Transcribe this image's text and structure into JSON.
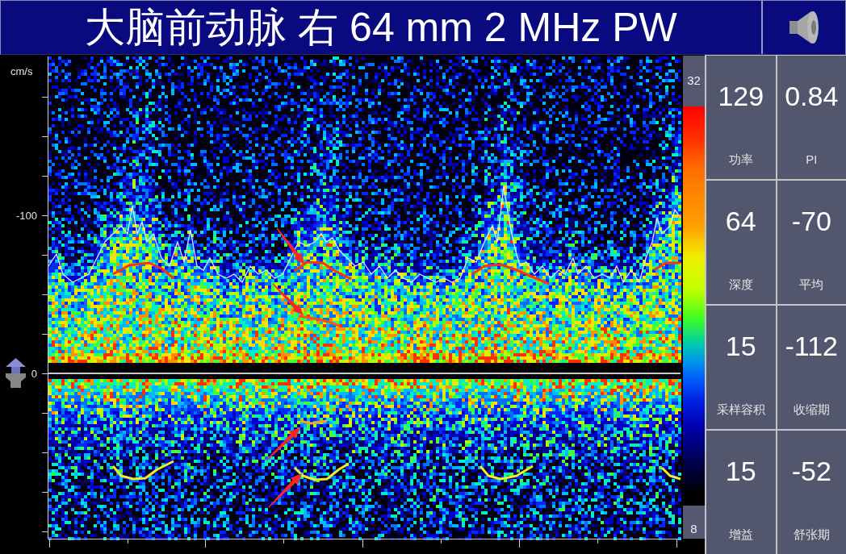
{
  "title_bar": {
    "title": "大脑前动脉 右 64 mm 2 MHz PW"
  },
  "velocity_axis": {
    "unit": "cm/s",
    "labels": [
      "-100",
      "0"
    ]
  },
  "color_scale": {
    "max": "32",
    "min": "8"
  },
  "measurements": [
    {
      "value": "129",
      "label": "功率"
    },
    {
      "value": "0.84",
      "label": "PI"
    },
    {
      "value": "64",
      "label": "深度"
    },
    {
      "value": "-70",
      "label": "平均"
    },
    {
      "value": "15",
      "label": "采样容积"
    },
    {
      "value": "-112",
      "label": "收缩期"
    },
    {
      "value": "15",
      "label": "增益"
    },
    {
      "value": "-52",
      "label": "舒张期"
    }
  ]
}
